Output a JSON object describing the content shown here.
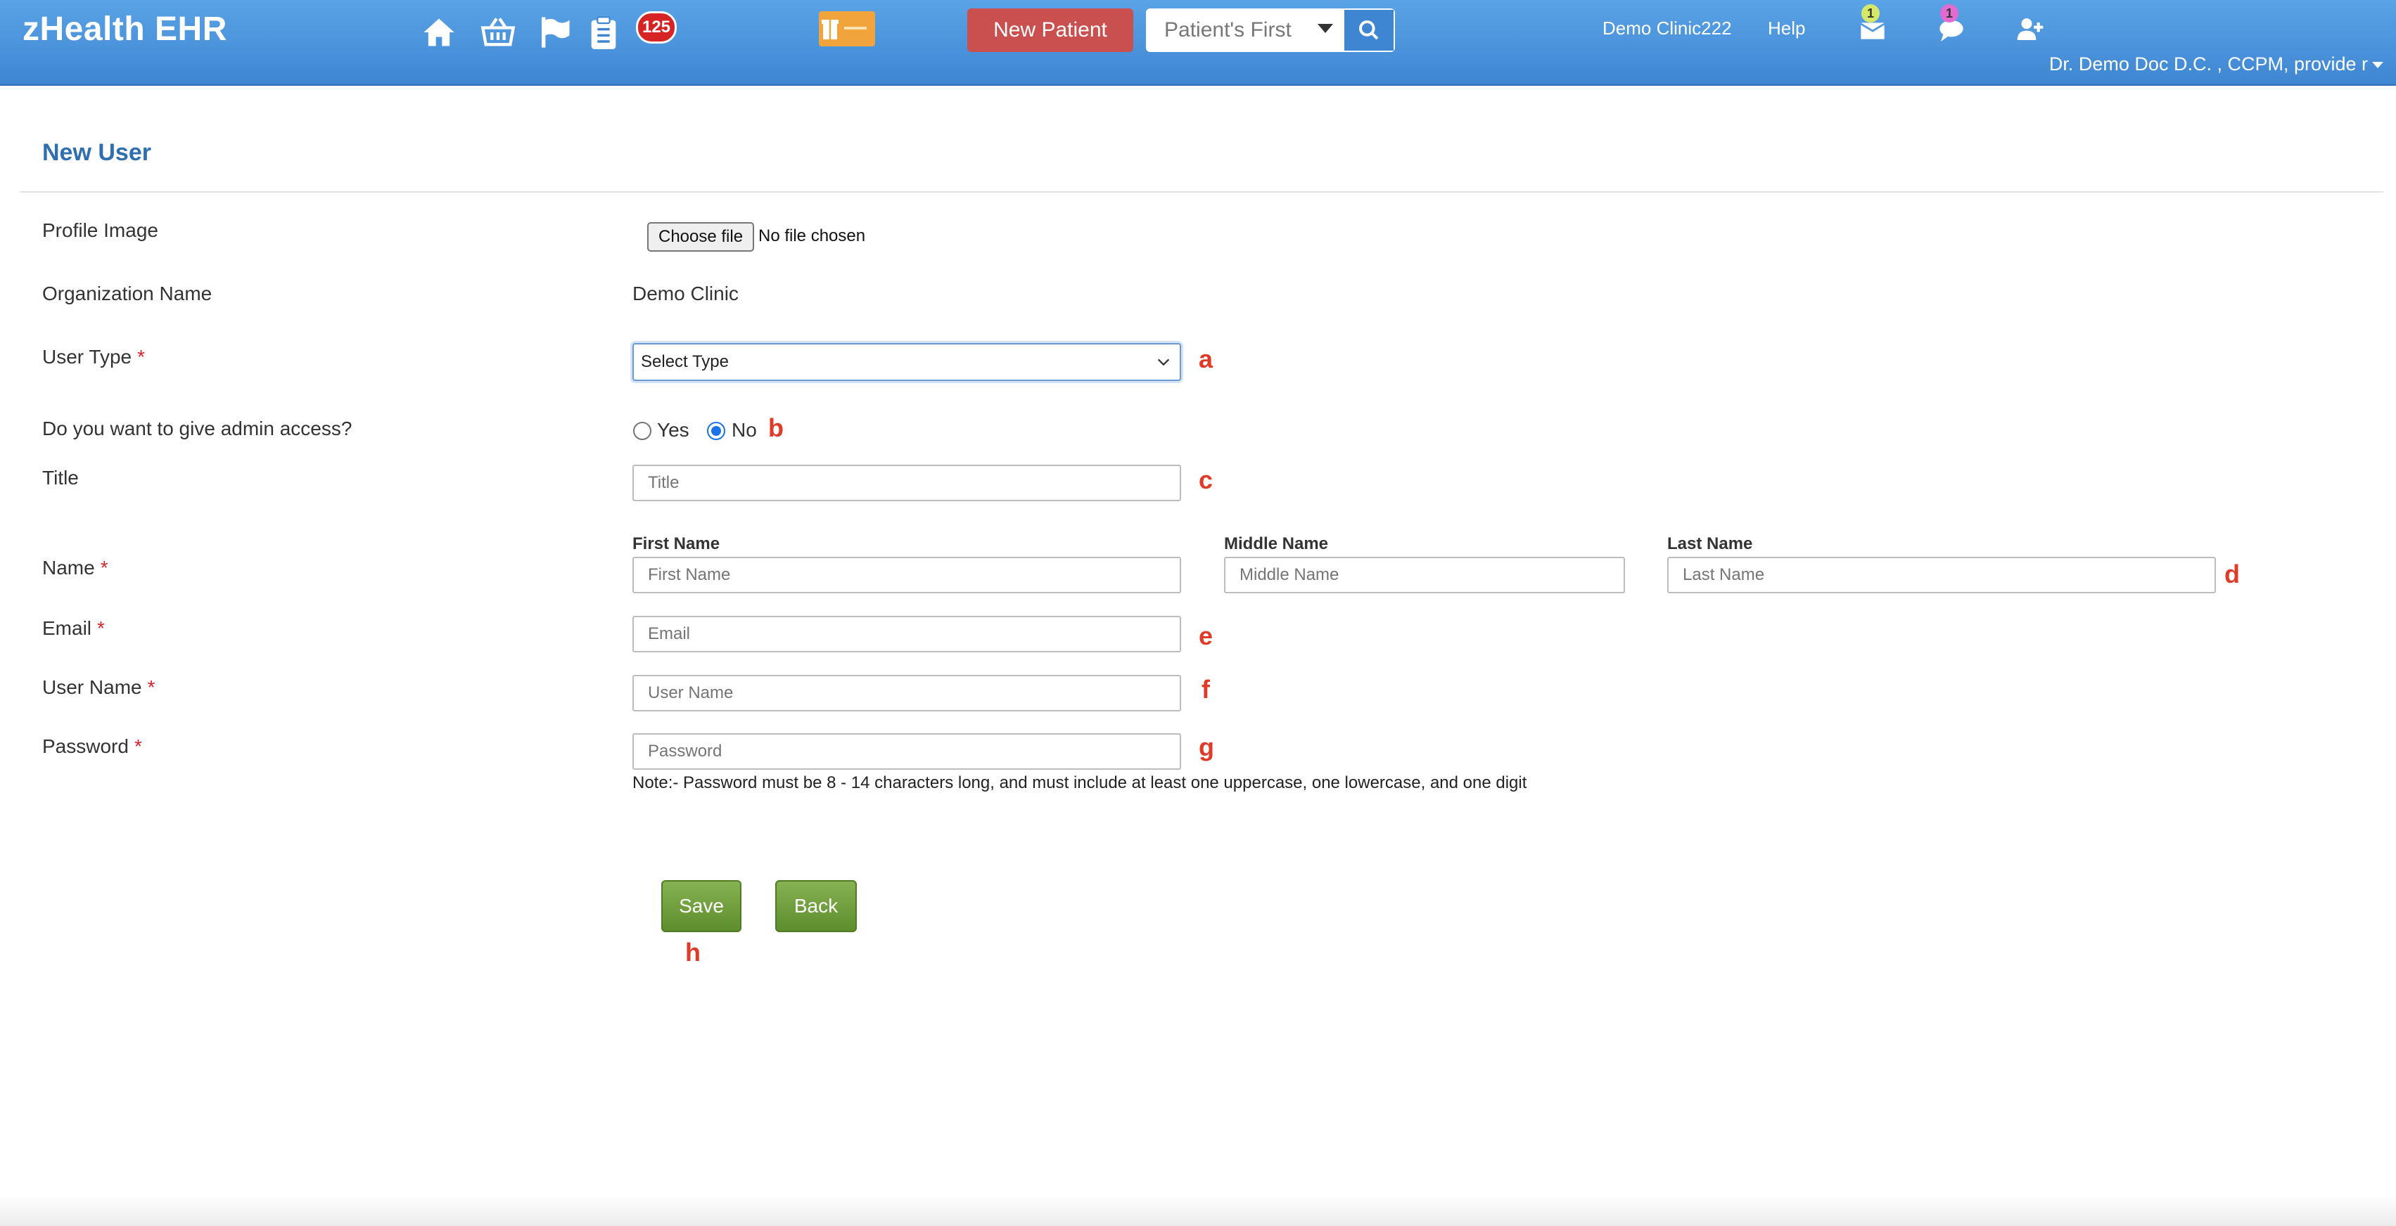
{
  "header": {
    "brand": "zHealth EHR",
    "nav_icons": [
      "home-icon",
      "basket-icon",
      "flag-icon",
      "clipboard-list-icon"
    ],
    "counter_badge": "125",
    "new_patient_label": "New Patient",
    "patient_search": {
      "value": "Patient's First"
    },
    "clinic_link": "Demo Clinic222",
    "help_link": "Help",
    "messages_badge": "1",
    "chat_badge": "1",
    "user_menu": "Dr. Demo Doc D.C. , CCPM, provide r",
    "colors": {
      "bar": "#4a93dc",
      "new_patient": "#c9504e",
      "gift": "#f1a33c"
    }
  },
  "page": {
    "title": "New User"
  },
  "form": {
    "profile_image": {
      "label": "Profile Image",
      "button": "Choose file",
      "status": "No file chosen"
    },
    "organization": {
      "label": "Organization Name",
      "value": "Demo Clinic"
    },
    "user_type": {
      "label": "User Type",
      "required": "*",
      "selected": "Select Type"
    },
    "admin_access": {
      "label": "Do you want to give admin access?",
      "options": [
        "Yes",
        "No"
      ],
      "selected": "No"
    },
    "title": {
      "label": "Title",
      "placeholder": "Title"
    },
    "name": {
      "label": "Name",
      "required": "*",
      "first": {
        "header": "First Name",
        "placeholder": "First Name"
      },
      "middle": {
        "header": "Middle Name",
        "placeholder": "Middle Name"
      },
      "last": {
        "header": "Last Name",
        "placeholder": "Last Name"
      }
    },
    "email": {
      "label": "Email",
      "required": "*",
      "placeholder": "Email"
    },
    "user_name": {
      "label": "User Name",
      "required": "*",
      "placeholder": "User Name"
    },
    "password": {
      "label": "Password",
      "required": "*",
      "placeholder": "Password"
    },
    "password_note": "Note:- Password must be 8 - 14 characters long, and must include at least one uppercase, one lowercase, and one digit",
    "save_label": "Save",
    "back_label": "Back",
    "accent_color": "#6a9a3a"
  },
  "annotations": [
    "a",
    "b",
    "c",
    "d",
    "e",
    "f",
    "g",
    "h"
  ]
}
